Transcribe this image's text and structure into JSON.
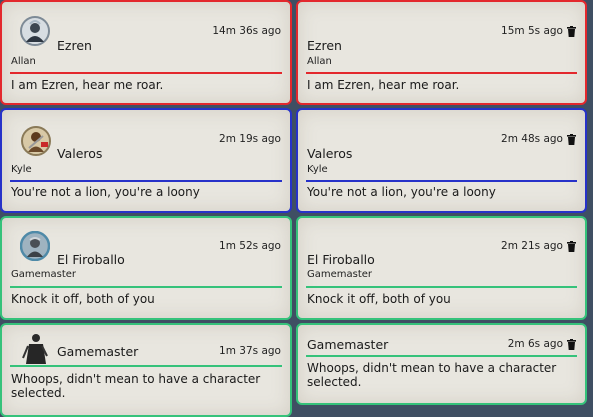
{
  "left_column": {
    "cards": [
      {
        "color": "#e3282d",
        "avatar": "ezren-token-icon",
        "speaker": "Ezren",
        "player": "Allan",
        "timestamp": "14m 36s ago",
        "message": "I am Ezren, hear me roar."
      },
      {
        "color": "#2732c9",
        "avatar": "valeros-token-icon",
        "speaker": "Valeros",
        "player": "Kyle",
        "timestamp": "2m 19s ago",
        "message": "You're not a lion, you're a loony"
      },
      {
        "color": "#35c27a",
        "avatar": "el-firoballo-token-icon",
        "speaker": "El Firoballo",
        "player": "Gamemaster",
        "timestamp": "1m 52s ago",
        "message": "Knock it off, both of you"
      },
      {
        "color": "#35c27a",
        "avatar": "gamemaster-figure-icon",
        "speaker": "Gamemaster",
        "timestamp": "1m 37s ago",
        "message": "Whoops, didn't mean to have a character selected."
      }
    ]
  },
  "right_column": {
    "cards": [
      {
        "color": "#e3282d",
        "speaker": "Ezren",
        "player": "Allan",
        "timestamp": "15m 5s ago",
        "message": "I am Ezren, hear me roar."
      },
      {
        "color": "#2732c9",
        "speaker": "Valeros",
        "player": "Kyle",
        "timestamp": "2m 48s ago",
        "message": "You're not a lion, you're a loony"
      },
      {
        "color": "#35c27a",
        "speaker": "El Firoballo",
        "player": "Gamemaster",
        "timestamp": "2m 21s ago",
        "message": "Knock it off, both of you"
      },
      {
        "color": "#35c27a",
        "speaker": "Gamemaster",
        "timestamp": "2m 6s ago",
        "message": "Whoops, didn't mean to have a character selected."
      }
    ]
  },
  "icons": {
    "delete": "trash-icon"
  }
}
